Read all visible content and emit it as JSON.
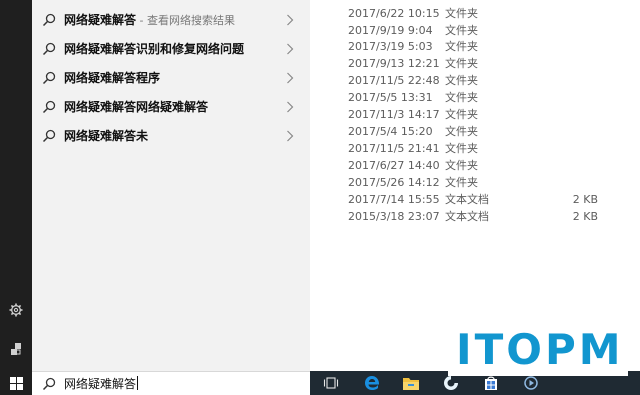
{
  "search": {
    "query": "网络疑难解答",
    "results": [
      {
        "label": "网络疑难解答",
        "hint": " - 查看网络搜索结果"
      },
      {
        "label": "网络疑难解答识别和修复网络问题",
        "hint": ""
      },
      {
        "label": "网络疑难解答程序",
        "hint": ""
      },
      {
        "label": "网络疑难解答网络疑难解答",
        "hint": ""
      },
      {
        "label": "网络疑难解答未",
        "hint": ""
      }
    ]
  },
  "files": [
    {
      "date": "2017/6/22 10:15",
      "type": "文件夹",
      "size": ""
    },
    {
      "date": "2017/9/19 9:04",
      "type": "文件夹",
      "size": ""
    },
    {
      "date": "2017/3/19 5:03",
      "type": "文件夹",
      "size": ""
    },
    {
      "date": "2017/9/13 12:21",
      "type": "文件夹",
      "size": ""
    },
    {
      "date": "2017/11/5 22:48",
      "type": "文件夹",
      "size": ""
    },
    {
      "date": "2017/5/5 13:31",
      "type": "文件夹",
      "size": ""
    },
    {
      "date": "2017/11/3 14:17",
      "type": "文件夹",
      "size": ""
    },
    {
      "date": "2017/5/4 15:20",
      "type": "文件夹",
      "size": ""
    },
    {
      "date": "2017/11/5 21:41",
      "type": "文件夹",
      "size": ""
    },
    {
      "date": "2017/6/27 14:40",
      "type": "文件夹",
      "size": ""
    },
    {
      "date": "2017/5/26 14:12",
      "type": "文件夹",
      "size": ""
    },
    {
      "date": "2017/7/14 15:55",
      "type": "文本文档",
      "size": "2 KB"
    },
    {
      "date": "2015/3/18 23:07",
      "type": "文本文档",
      "size": "2 KB"
    }
  ],
  "watermark": {
    "text": "ITOPM"
  },
  "icons": {
    "rail": [
      "settings-icon",
      "user-icon",
      "windows-start-icon"
    ],
    "taskbar": [
      "task-view-icon",
      "edge-browser-icon",
      "file-explorer-icon",
      "app-icon",
      "store-icon",
      "media-icon"
    ]
  },
  "colors": {
    "accent": "#1296cf",
    "rail": "#1f1f1f",
    "panel": "#f2f2f2",
    "taskbar": "#1f2a33"
  }
}
